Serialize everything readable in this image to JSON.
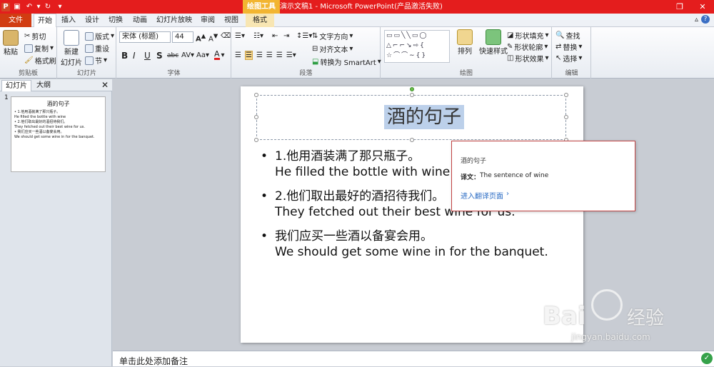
{
  "window": {
    "title": "演示文稿1 - Microsoft PowerPoint(产品激活失败)",
    "context_group": "绘图工具",
    "context_tab": "格式"
  },
  "tabs": [
    "文件",
    "开始",
    "插入",
    "设计",
    "切换",
    "动画",
    "幻灯片放映",
    "审阅",
    "视图",
    "格式"
  ],
  "ribbon": {
    "clipboard": {
      "paste": "粘贴",
      "cut": "剪切",
      "copy": "复制",
      "format_painter": "格式刷",
      "label": "剪贴板"
    },
    "slides": {
      "new_slide": "新建",
      "new_slide2": "幻灯片",
      "layout": "版式",
      "reset": "重设",
      "section": "节",
      "label": "幻灯片"
    },
    "font": {
      "name": "宋体 (标题)",
      "size": "44",
      "label": "字体",
      "bold": "B",
      "italic": "I",
      "underline": "U",
      "strike": "S",
      "shadow": "abc"
    },
    "paragraph": {
      "text_direction": "文字方向",
      "align_text": "对齐文本",
      "smartart": "转换为 SmartArt",
      "label": "段落"
    },
    "drawing": {
      "arrange": "排列",
      "quick_styles": "快速样式",
      "shape_fill": "形状填充",
      "shape_outline": "形状轮廓",
      "shape_effects": "形状效果",
      "label": "绘图"
    },
    "editing": {
      "find": "查找",
      "replace": "替换",
      "select": "选择",
      "label": "编辑"
    }
  },
  "left_pane": {
    "tab_slides": "幻灯片",
    "tab_outline": "大纲",
    "slide_number": "1",
    "thumb_title": "酒的句子",
    "thumb_lines": [
      "• 1.他用酒装满了那只瓶子。",
      "He filled the bottle with wine",
      "• 2.他们取出最好的酒招待我们。",
      "They fetched out their best wine for us.",
      "• 我们应买一些酒以备宴会用。",
      "We should get some wine in for the banquet."
    ]
  },
  "slide": {
    "title": "酒的句子",
    "bullets": [
      {
        "cn": "1.他用酒装满了那只瓶子。",
        "en": "He filled the bottle with wine"
      },
      {
        "cn": "2.他们取出最好的酒招待我们。",
        "en": "They fetched out their best wine for us."
      },
      {
        "cn": "我们应买一些酒以备宴会用。",
        "en": "We should get some wine in for the banquet."
      }
    ]
  },
  "popup": {
    "source": "酒的句子",
    "label": "译文：",
    "translation": "The sentence of wine",
    "link": "进入翻译页面"
  },
  "notes": {
    "placeholder": "单击此处添加备注"
  },
  "watermark": {
    "brand": "Bai",
    "brand2": "经验",
    "url": "jingyan.baidu.com"
  }
}
